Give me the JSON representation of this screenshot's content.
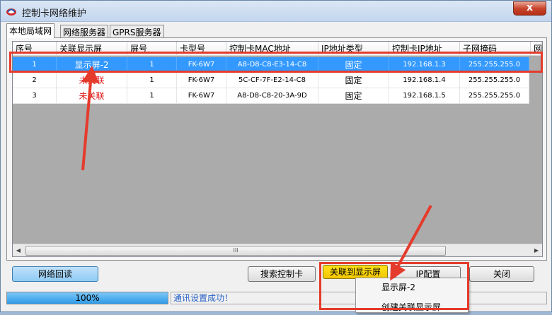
{
  "window": {
    "title": "控制卡网络维护",
    "close_label": "x"
  },
  "tabs": [
    {
      "label": "本地局域网",
      "active": true
    },
    {
      "label": "网络服务器",
      "active": false
    },
    {
      "label": "GPRS服务器",
      "active": false
    }
  ],
  "table": {
    "columns": [
      "序号",
      "关联显示屏",
      "屏号",
      "卡型号",
      "控制卡MAC地址",
      "IP地址类型",
      "控制卡IP地址",
      "子网掩码",
      "网"
    ],
    "rows": [
      {
        "cells": [
          "1",
          "显示屏-2",
          "1",
          "FK-6W7",
          "A8-D8-C8-E3-14-C8",
          "固定",
          "192.168.1.3",
          "255.255.255.0"
        ],
        "selected": true,
        "unlinked": false
      },
      {
        "cells": [
          "2",
          "未关联",
          "1",
          "FK-6W7",
          "5C-CF-7F-E2-14-C8",
          "固定",
          "192.168.1.4",
          "255.255.255.0"
        ],
        "selected": false,
        "unlinked": true
      },
      {
        "cells": [
          "3",
          "未关联",
          "1",
          "FK-6W7",
          "A8-D8-C8-20-3A-9D",
          "固定",
          "192.168.1.5",
          "255.255.255.0"
        ],
        "selected": false,
        "unlinked": true
      }
    ],
    "scroll_thumb_grip": "III"
  },
  "buttons": {
    "network_readback": "网络回读",
    "search_card": "搜索控制卡",
    "link_to_screen": "关联到显示屏",
    "ip_config": "IP配置",
    "close": "关闭"
  },
  "context_menu": {
    "items": [
      "显示屏-2",
      "创建关联显示屏"
    ]
  },
  "status": {
    "progress_text": "100%",
    "progress": 1.0,
    "message": "通讯设置成功！"
  },
  "colors": {
    "selection": "#3399ff",
    "annotation_red": "#e53b2c",
    "unlinked_text": "#e02020",
    "highlight_button": "#f2c600"
  }
}
